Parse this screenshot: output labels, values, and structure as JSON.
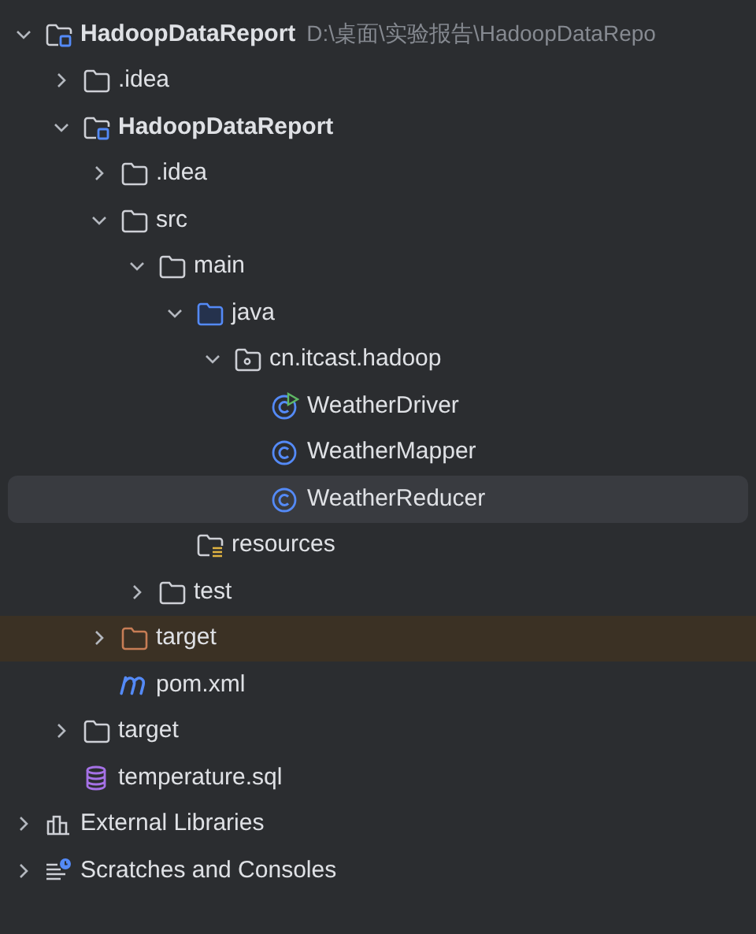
{
  "tree": [
    {
      "label": "HadoopDataReport",
      "kind": "module",
      "path": "D:\\桌面\\实验报告\\HadoopDataRepo",
      "expanded": true,
      "selected": false,
      "children": [
        {
          "label": ".idea",
          "kind": "folder",
          "expanded": false,
          "selected": false
        },
        {
          "label": "HadoopDataReport",
          "kind": "module",
          "expanded": true,
          "selected": false,
          "children": [
            {
              "label": ".idea",
              "kind": "folder",
              "expanded": false,
              "selected": false
            },
            {
              "label": "src",
              "kind": "folder",
              "expanded": true,
              "selected": false,
              "children": [
                {
                  "label": "main",
                  "kind": "folder",
                  "expanded": true,
                  "selected": false,
                  "children": [
                    {
                      "label": "java",
                      "kind": "source",
                      "expanded": true,
                      "selected": false,
                      "children": [
                        {
                          "label": "cn.itcast.hadoop",
                          "kind": "package",
                          "expanded": true,
                          "selected": false,
                          "children": [
                            {
                              "label": "WeatherDriver",
                              "kind": "runnable-class",
                              "selected": false
                            },
                            {
                              "label": "WeatherMapper",
                              "kind": "class",
                              "selected": false
                            },
                            {
                              "label": "WeatherReducer",
                              "kind": "class",
                              "selected": true
                            }
                          ]
                        }
                      ]
                    },
                    {
                      "label": "resources",
                      "kind": "resources",
                      "selected": false
                    }
                  ]
                },
                {
                  "label": "test",
                  "kind": "folder",
                  "expanded": false,
                  "selected": false
                }
              ]
            },
            {
              "label": "target",
              "kind": "excluded",
              "expanded": false,
              "selected": false
            },
            {
              "label": "pom.xml",
              "kind": "maven",
              "selected": false
            }
          ]
        },
        {
          "label": "target",
          "kind": "folder",
          "expanded": false,
          "selected": false
        },
        {
          "label": "temperature.sql",
          "kind": "sql",
          "selected": false
        }
      ]
    },
    {
      "label": "External Libraries",
      "kind": "libraries",
      "expanded": false,
      "selected": false
    },
    {
      "label": "Scratches and Consoles",
      "kind": "scratches",
      "expanded": false,
      "selected": false
    }
  ]
}
